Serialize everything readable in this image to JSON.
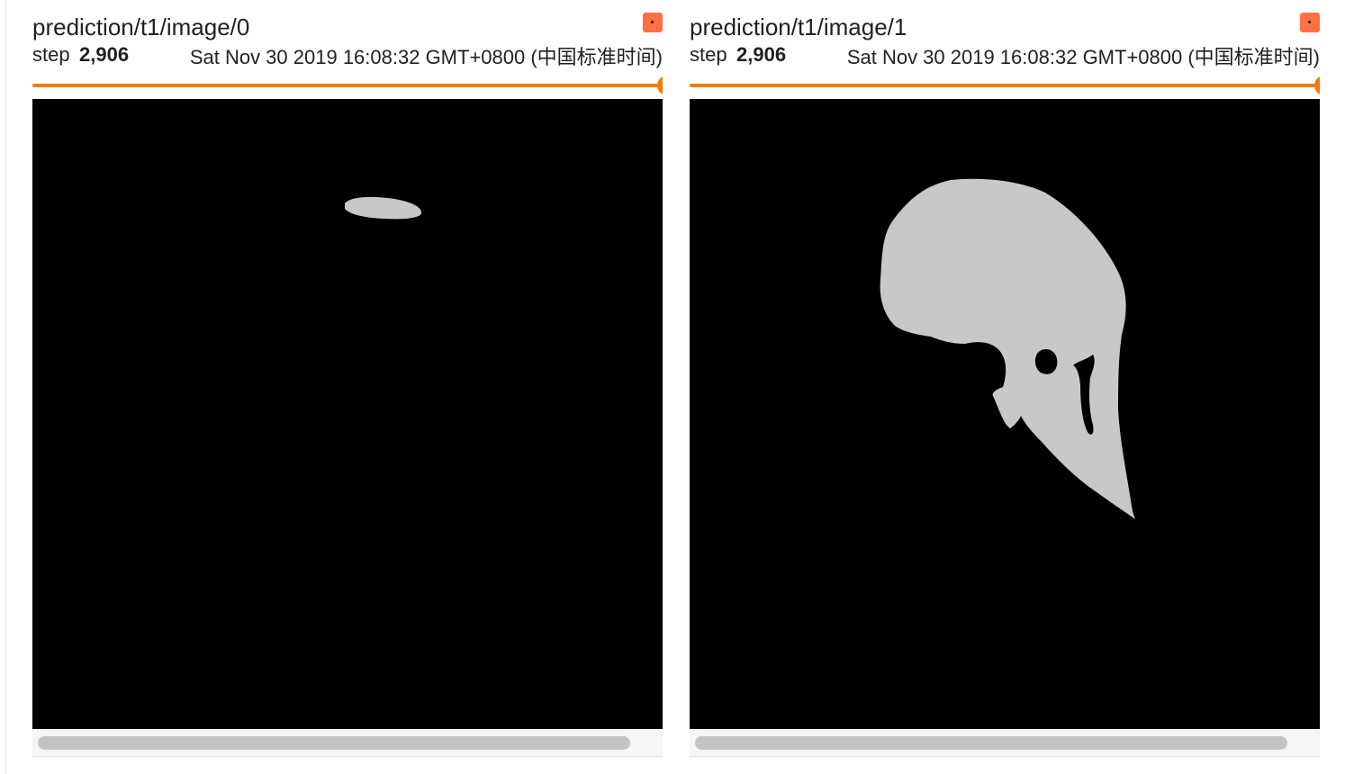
{
  "cards": [
    {
      "title": "prediction/t1/image/0",
      "step_label": "step",
      "step_value": "2,906",
      "timestamp": "Sat Nov 30 2019 16:08:32 GMT+0800 (中国标准时间)",
      "slider_position": 1.0,
      "expand_icon": "expand-icon"
    },
    {
      "title": "prediction/t1/image/1",
      "step_label": "step",
      "step_value": "2,906",
      "timestamp": "Sat Nov 30 2019 16:08:32 GMT+0800 (中国标准时间)",
      "slider_position": 1.0,
      "expand_icon": "expand-icon"
    }
  ],
  "colors": {
    "accent": "#f57c00",
    "expand_button": "#ff7043",
    "mask_foreground": "#c8c8c8",
    "image_background": "#000000"
  }
}
